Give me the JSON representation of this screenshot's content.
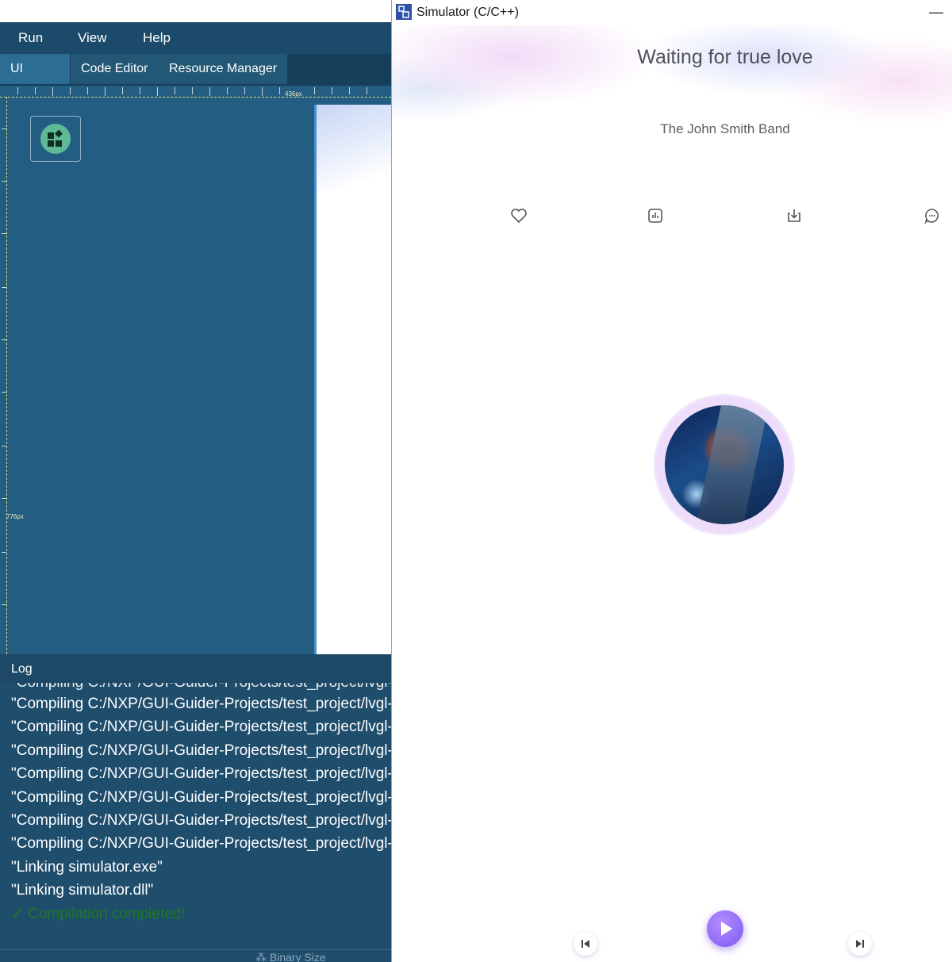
{
  "ide": {
    "menu": [
      "Run",
      "View",
      "Help"
    ],
    "tabs": [
      "UI Editor",
      "Code Editor",
      "Resource Manager"
    ],
    "active_tab": "UI Editor",
    "ruler": {
      "width_label": "436px",
      "height_label": "776px"
    },
    "log": {
      "title": "Log",
      "lines": [
        "\"Compiling C:/NXP/GUI-Guider-Projects/test_project/lvgl-s",
        "\"Compiling C:/NXP/GUI-Guider-Projects/test_project/lvgl-s",
        "\"Compiling C:/NXP/GUI-Guider-Projects/test_project/lvgl-s",
        "\"Compiling C:/NXP/GUI-Guider-Projects/test_project/lvgl-s",
        "\"Compiling C:/NXP/GUI-Guider-Projects/test_project/lvgl-s",
        "\"Compiling C:/NXP/GUI-Guider-Projects/test_project/lvgl-s",
        "\"Compiling C:/NXP/GUI-Guider-Projects/test_project/lvgl-s",
        "\"Linking simulator.exe\"",
        "\"Linking simulator.dll\""
      ],
      "success": "✓ Compilation completed!",
      "footer": "Binary Size"
    }
  },
  "simulator": {
    "title": "Simulator (C/C++)",
    "minimize": "—",
    "song_title": "Waiting for true love",
    "artist": "The John Smith Band",
    "icons": [
      "heart-icon",
      "chart-icon",
      "download-icon",
      "chat-icon"
    ],
    "colors": {
      "accent": "#8b6cf5",
      "ring": "#eedcfb",
      "ide_bg": "#1e4f70"
    }
  }
}
